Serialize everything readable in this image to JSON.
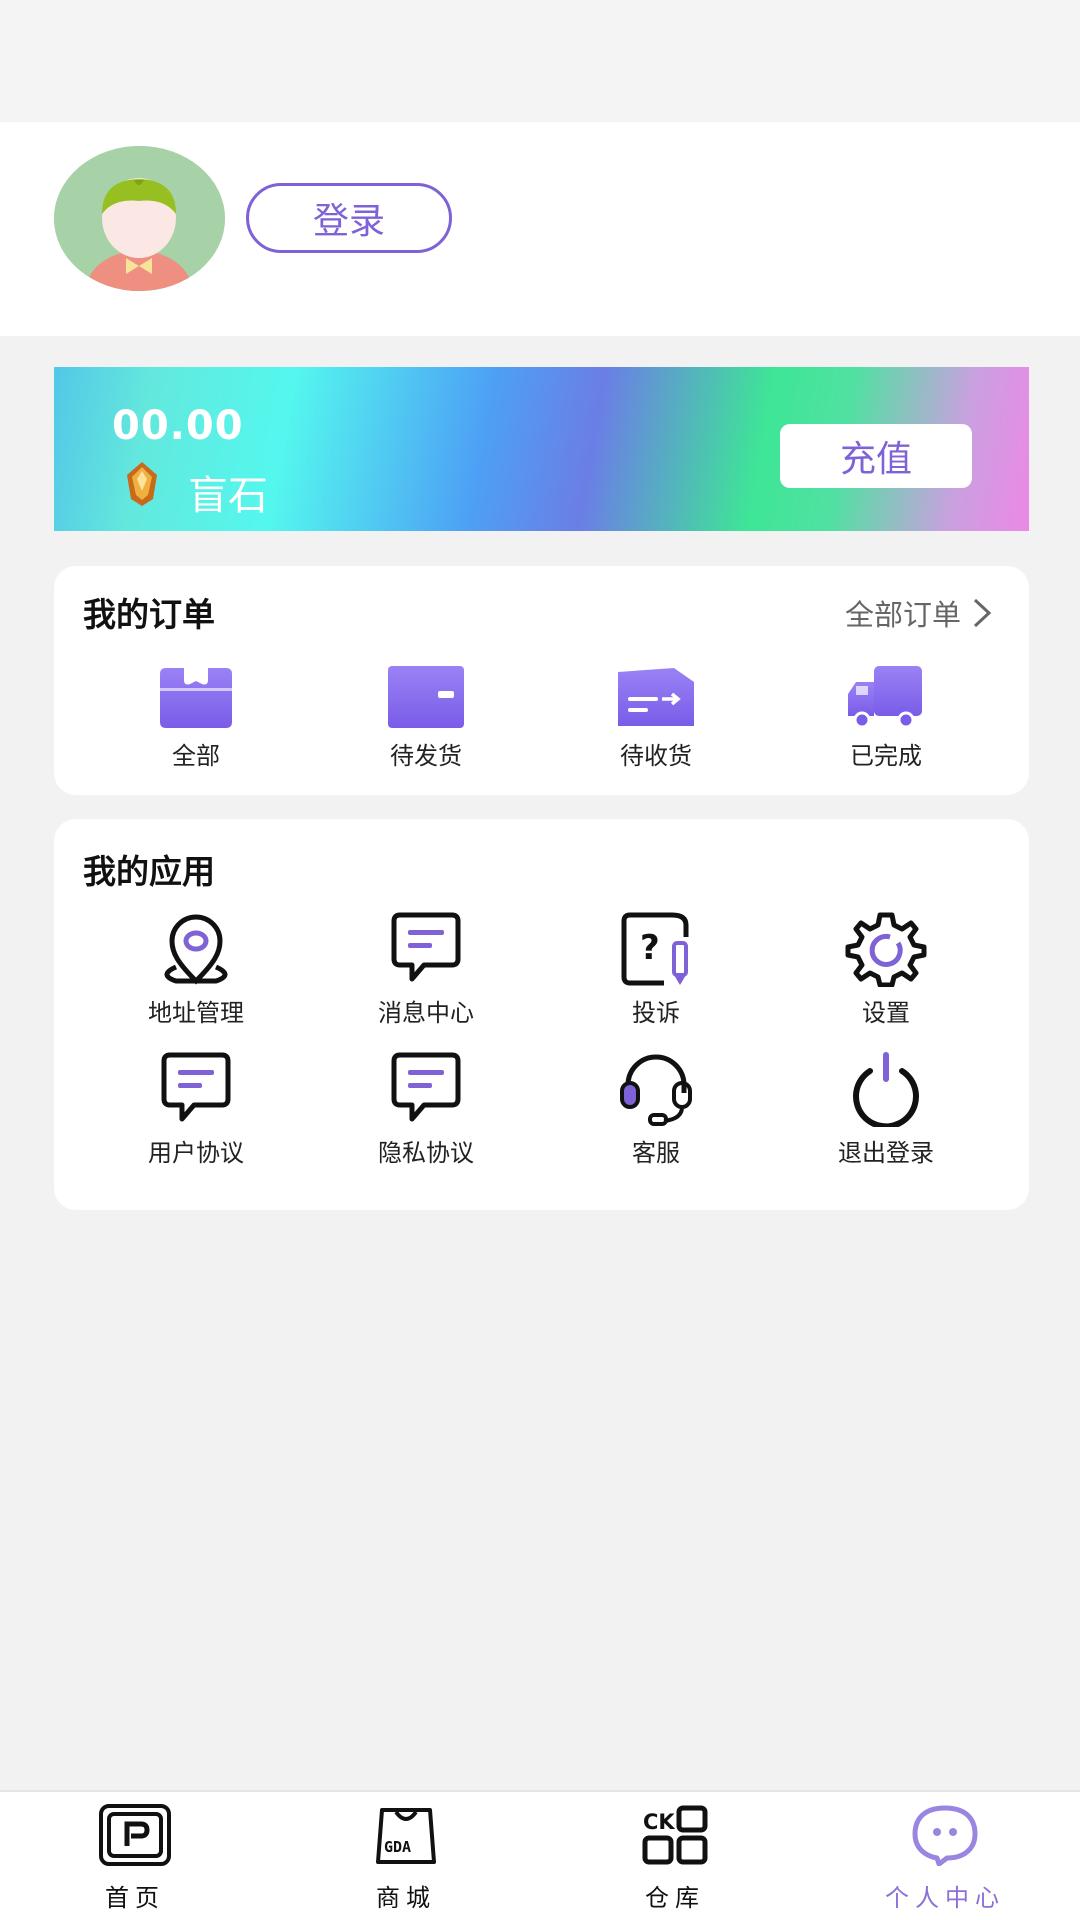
{
  "profile": {
    "login_label": "登录"
  },
  "balance": {
    "amount": "00.00",
    "unit": "盲石",
    "recharge_label": "充值"
  },
  "orders": {
    "title": "我的订单",
    "all_label": "全部订单",
    "items": [
      {
        "label": "全部",
        "icon": "box-icon"
      },
      {
        "label": "待发货",
        "icon": "package-icon"
      },
      {
        "label": "待收货",
        "icon": "delivery-icon"
      },
      {
        "label": "已完成",
        "icon": "truck-icon"
      }
    ]
  },
  "apps": {
    "title": "我的应用",
    "items": [
      {
        "label": "地址管理",
        "icon": "location-pin-icon"
      },
      {
        "label": "消息中心",
        "icon": "message-icon"
      },
      {
        "label": "投诉",
        "icon": "complaint-icon"
      },
      {
        "label": "设置",
        "icon": "gear-icon"
      },
      {
        "label": "用户协议",
        "icon": "user-agreement-icon"
      },
      {
        "label": "隐私协议",
        "icon": "privacy-agreement-icon"
      },
      {
        "label": "客服",
        "icon": "headset-icon"
      },
      {
        "label": "退出登录",
        "icon": "power-icon"
      }
    ]
  },
  "tabbar": {
    "items": [
      {
        "label": "首页",
        "icon": "home-p-icon"
      },
      {
        "label": "商城",
        "icon": "shop-bag-icon"
      },
      {
        "label": "仓库",
        "icon": "warehouse-icon"
      },
      {
        "label": "个人中心",
        "icon": "profile-chat-icon"
      }
    ],
    "active_index": 3
  },
  "colors": {
    "accent": "#7e62d6",
    "active_tab": "#8c6fd8"
  }
}
